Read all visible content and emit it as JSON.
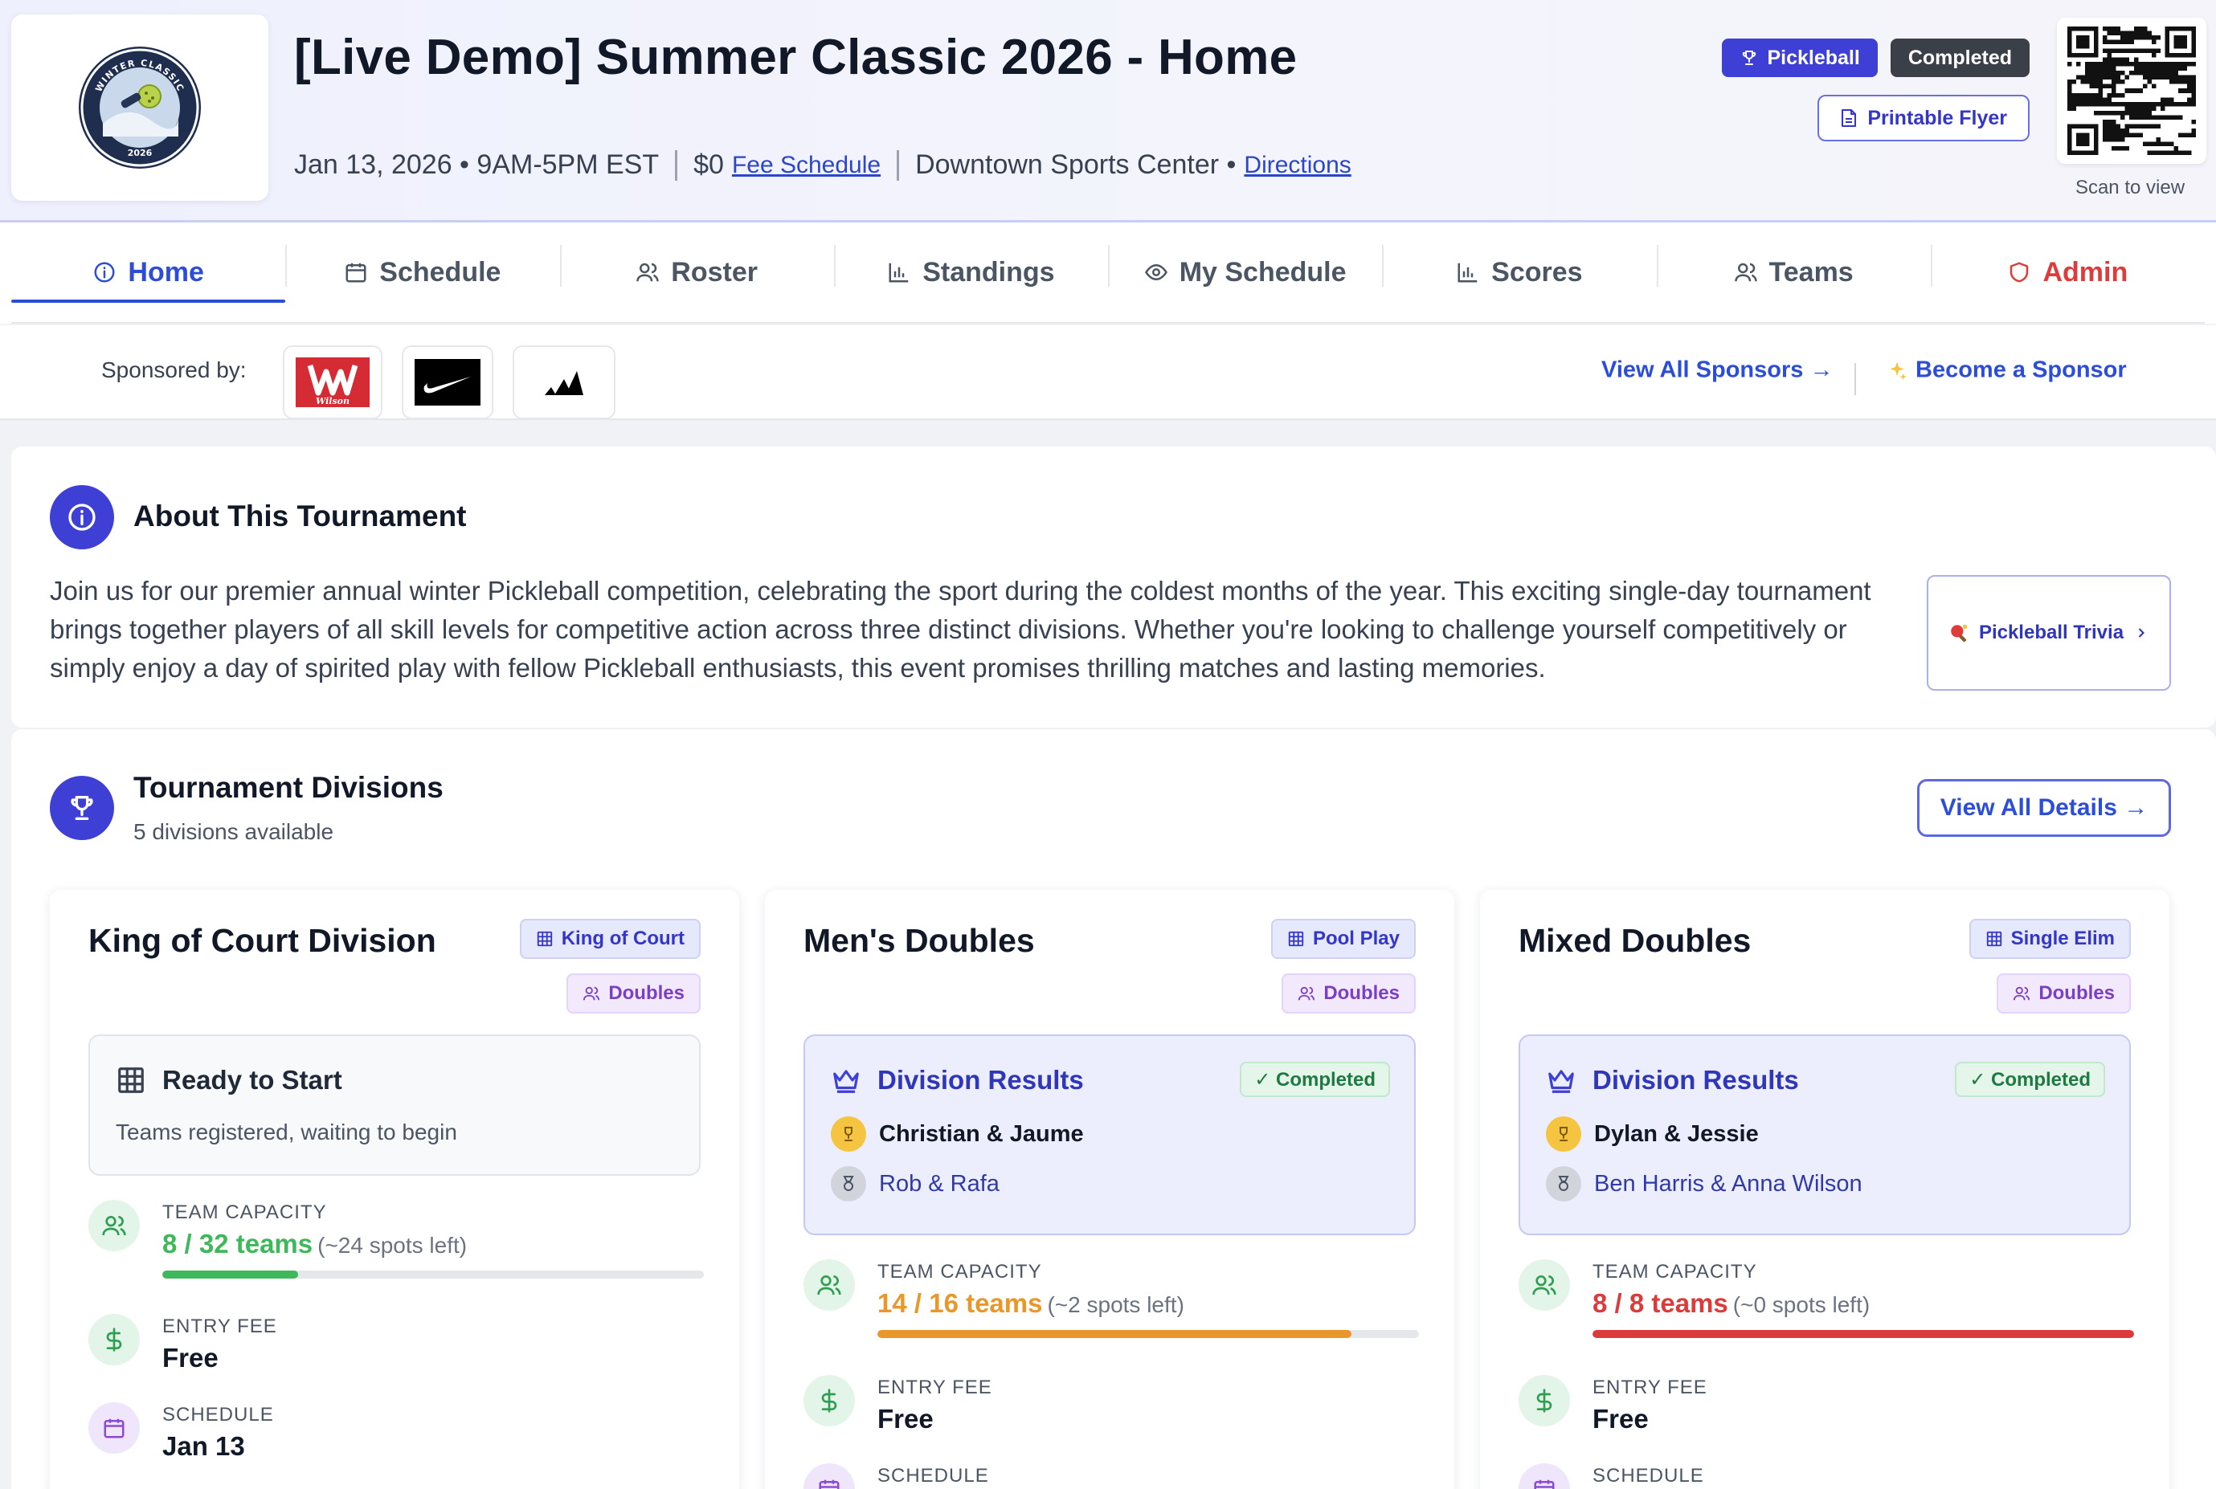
{
  "header": {
    "logo_text_top": "WINTER CLASSIC",
    "logo_text_bottom": "2026",
    "title": "[Live Demo] Summer Classic 2026 - Home",
    "date_time": "Jan 13, 2026 • 9AM-5PM EST",
    "price": "$0",
    "fee_link": "Fee Schedule",
    "venue": "Downtown Sports Center •",
    "directions_link": "Directions",
    "sport_badge": "Pickleball",
    "status_badge": "Completed",
    "flyer_button": "Printable Flyer",
    "qr_caption": "Scan to view"
  },
  "tabs": [
    {
      "label": "Home",
      "icon": "info-icon",
      "active": true
    },
    {
      "label": "Schedule",
      "icon": "calendar-icon"
    },
    {
      "label": "Roster",
      "icon": "users-icon"
    },
    {
      "label": "Standings",
      "icon": "bar-chart-icon"
    },
    {
      "label": "My Schedule",
      "icon": "eye-icon"
    },
    {
      "label": "Scores",
      "icon": "bar-chart-icon"
    },
    {
      "label": "Teams",
      "icon": "users-icon"
    },
    {
      "label": "Admin",
      "icon": "shield-icon"
    }
  ],
  "sponsors": {
    "label": "Sponsored by:",
    "logos": [
      "wilson-logo",
      "nike-logo",
      "adidas-logo"
    ],
    "wilson_wordmark": "Wilson",
    "view_all": "View All Sponsors →",
    "become": "Become a Sponsor"
  },
  "about": {
    "title": "About This Tournament",
    "text": "Join us for our premier annual winter Pickleball competition, celebrating the sport during the coldest months of the year. This exciting single-day tournament brings together players of all skill levels for competitive action across three distinct divisions. Whether you're looking to challenge yourself competitively or simply enjoy a day of spirited play with fellow Pickleball enthusiasts, this event promises thrilling matches and lasting memories.",
    "trivia_button": "Pickleball Trivia"
  },
  "divisions": {
    "title": "Tournament Divisions",
    "subtitle": "5 divisions available",
    "view_all": "View All Details →",
    "cards": [
      {
        "title": "King of Court Division",
        "format": "King of Court",
        "type": "Doubles",
        "status_title": "Ready to Start",
        "status_sub": "Teams registered, waiting to begin",
        "capacity_label": "TEAM CAPACITY",
        "capacity": "8 / 32 teams",
        "spots": "(~24 spots left)",
        "capacity_fraction": 0.25,
        "capacity_color": "#3fb75b",
        "fee_label": "ENTRY FEE",
        "fee": "Free",
        "schedule_label": "SCHEDULE",
        "schedule": "Jan 13"
      },
      {
        "title": "Men's Doubles",
        "format": "Pool Play",
        "type": "Doubles",
        "results_title": "Division Results",
        "completed": "✓ Completed",
        "first": "Christian & Jaume",
        "second": "Rob & Rafa",
        "capacity_label": "TEAM CAPACITY",
        "capacity": "14 / 16 teams",
        "spots": "(~2 spots left)",
        "capacity_fraction": 0.875,
        "capacity_color": "#e9972a",
        "fee_label": "ENTRY FEE",
        "fee": "Free",
        "schedule_label": "SCHEDULE"
      },
      {
        "title": "Mixed Doubles",
        "format": "Single Elim",
        "type": "Doubles",
        "results_title": "Division Results",
        "completed": "✓ Completed",
        "first": "Dylan & Jessie",
        "second": "Ben Harris & Anna Wilson",
        "capacity_label": "TEAM CAPACITY",
        "capacity": "8 / 8 teams",
        "spots": "(~0 spots left)",
        "capacity_fraction": 1.0,
        "capacity_color": "#dc3b3b",
        "fee_label": "ENTRY FEE",
        "fee": "Free",
        "schedule_label": "SCHEDULE"
      }
    ]
  },
  "colors": {
    "accent": "#3e3fd4",
    "link": "#2c4dd8",
    "admin": "#e03b3b",
    "capacity_green": "#3fb75b",
    "capacity_orange": "#e9972a",
    "capacity_red": "#dc3b3b"
  }
}
